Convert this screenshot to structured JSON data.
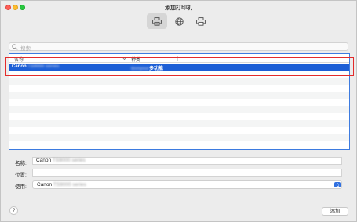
{
  "window": {
    "title": "添加打印机"
  },
  "toolbar": {
    "items": [
      {
        "icon": "printer-icon",
        "active": true
      },
      {
        "icon": "globe-icon",
        "active": false
      },
      {
        "icon": "printer-icon",
        "active": false
      }
    ]
  },
  "search": {
    "placeholder": "搜索"
  },
  "table": {
    "columns": [
      "名称",
      "种类"
    ],
    "rows": [
      {
        "name_prefix": "Canon",
        "name_blurred": "TS9000 series",
        "kind_blurred": "Bonjour",
        "kind_suffix": "多功能"
      }
    ]
  },
  "form": {
    "name_label": "名称:",
    "name_value_prefix": "Canon",
    "name_value_blurred": "TS9000 series",
    "location_label": "位置:",
    "location_value": "",
    "use_label": "使用:",
    "use_value_prefix": "Canon",
    "use_value_blurred": "TS9000 series"
  },
  "footer": {
    "help_label": "?",
    "add_label": "添加"
  },
  "colors": {
    "accent": "#1d5fd6",
    "highlight": "#e32b2b",
    "close": "#fe5f57",
    "minimize": "#febc2e",
    "zoom": "#28c840"
  }
}
